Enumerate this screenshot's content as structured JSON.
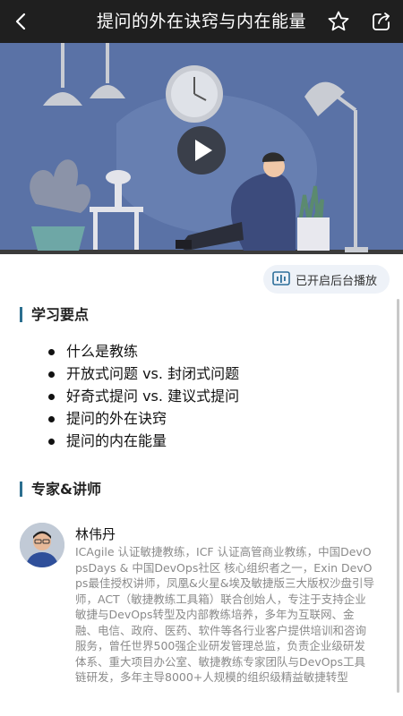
{
  "header": {
    "title": "提问的外在诀窍与内在能量",
    "back_icon": "back-arrow-icon",
    "favorite_icon": "star-icon",
    "share_icon": "share-icon"
  },
  "video": {
    "play_icon": "play-icon"
  },
  "background_play": {
    "label": "已开启后台播放",
    "icon": "audio-wave-icon"
  },
  "key_points": {
    "heading": "学习要点",
    "items": [
      "什么是教练",
      "开放式问题 vs. 封闭式问题",
      "好奇式提问 vs. 建议式提问",
      "提问的外在诀窍",
      "提问的内在能量"
    ]
  },
  "experts": {
    "heading": "专家&讲师",
    "name": "林伟丹",
    "bio": " ICAgile 认证敏捷教练，ICF 认证高管商业教练，中国DevOpsDays & 中国DevOps社区 核心组织者之一，Exin DevOps最佳授权讲师，凤凰&火星&埃及敏捷版三大版权沙盘引导师，ACT（敏捷教练工具箱）联合创始人，专注于支持企业敏捷与DevOps转型及内部教练培养，多年为互联网、金融、电信、政府、医药、软件等各行业客户提供培训和咨询服务，曾任世界500强企业研发管理总监，负责企业级研发体系、重大项目办公室、敏捷教练专家团队与DevOps工具链研发，多年主导8000+人规模的组织级精益敏捷转型"
  },
  "colors": {
    "topbar": "#1f1f1f",
    "video_bg": "#5a72a6",
    "accent": "#2c6f8f",
    "pill_bg": "#eef2f8"
  }
}
